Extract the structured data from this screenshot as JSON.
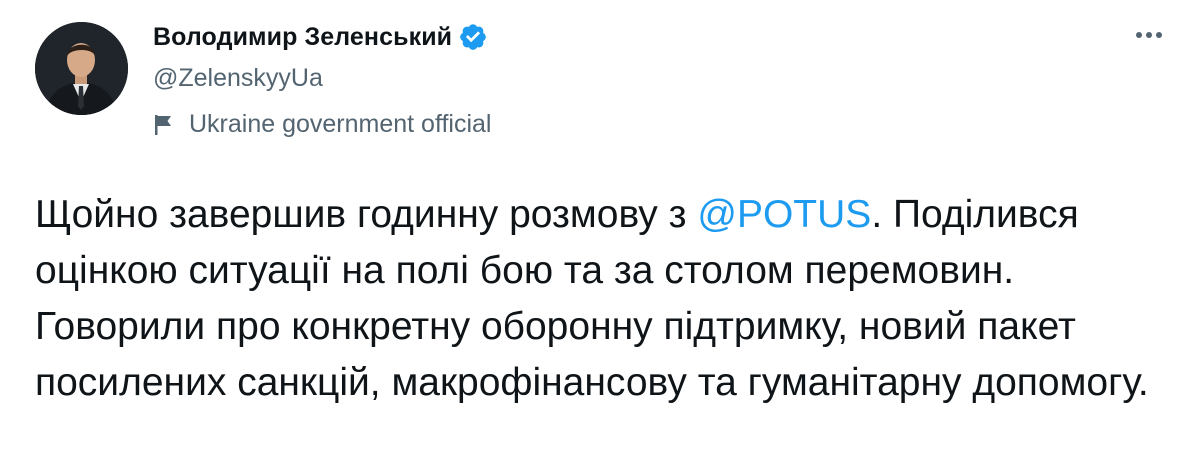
{
  "author": {
    "display_name": "Володимир Зеленський",
    "handle": "@ZelenskyyUa",
    "verified": true,
    "label": "Ukraine government official"
  },
  "tweet": {
    "text_before": "Щойно завершив годинну розмову з ",
    "mention": "@POTUS",
    "text_after": ". Поділився оцінкою ситуації на полі бою та за столом перемовин. Говорили про конкретну оборонну підтримку, новий пакет посилених санкцій, макрофінансову та гуманітарну допомогу."
  },
  "colors": {
    "accent": "#1d9bf0",
    "text": "#0f1419",
    "secondary": "#536471"
  },
  "icons": [
    "verified-badge-icon",
    "flag-icon",
    "more-options-icon"
  ]
}
